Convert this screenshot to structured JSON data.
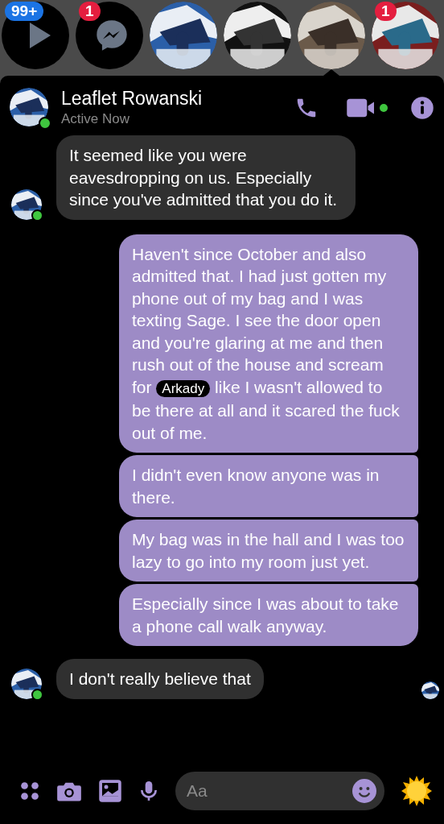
{
  "chat_heads": [
    {
      "kind": "video",
      "badge": {
        "text": "99+",
        "color": "#1b74e4"
      },
      "selected": false
    },
    {
      "kind": "messenger",
      "badge": {
        "text": "1",
        "color": "#e41e3f"
      },
      "selected": false
    },
    {
      "kind": "picture",
      "selected": false
    },
    {
      "kind": "picture",
      "selected": false
    },
    {
      "kind": "picture",
      "selected": true
    },
    {
      "kind": "picture",
      "badge": {
        "text": "1",
        "color": "#e41e3f"
      },
      "selected": false
    }
  ],
  "header": {
    "name": "Leaflet Rowanski",
    "status": "Active Now",
    "online": true
  },
  "messages": [
    {
      "kind": "incoming",
      "parts": [
        {
          "text": "It seemed like you were eavesdropping on us. Especially since you've admitted that you do it."
        }
      ]
    },
    {
      "kind": "outgoing",
      "parts": [
        {
          "text": "Haven't since October and also admitted that. I had just gotten my phone out of my bag and I was texting Sage. I see the door open and you're glaring at me and then rush out of the house and scream for "
        },
        {
          "text": "Arkady",
          "kind": "tag"
        },
        {
          "text": " like I wasn't allowed to be there at all and it scared the fuck out of me."
        }
      ]
    },
    {
      "kind": "outgoing",
      "parts": [
        {
          "text": "I didn't even know anyone was in there."
        }
      ]
    },
    {
      "kind": "outgoing",
      "parts": [
        {
          "text": "My bag was in the hall and I was too lazy to go into my room just yet."
        }
      ]
    },
    {
      "kind": "outgoing",
      "parts": [
        {
          "text": "Especially since I was about to take a phone call walk anyway."
        }
      ]
    },
    {
      "kind": "incoming",
      "seen": true,
      "parts": [
        {
          "text": "I don't really believe that"
        }
      ]
    }
  ],
  "composer": {
    "placeholder": "Aa"
  }
}
